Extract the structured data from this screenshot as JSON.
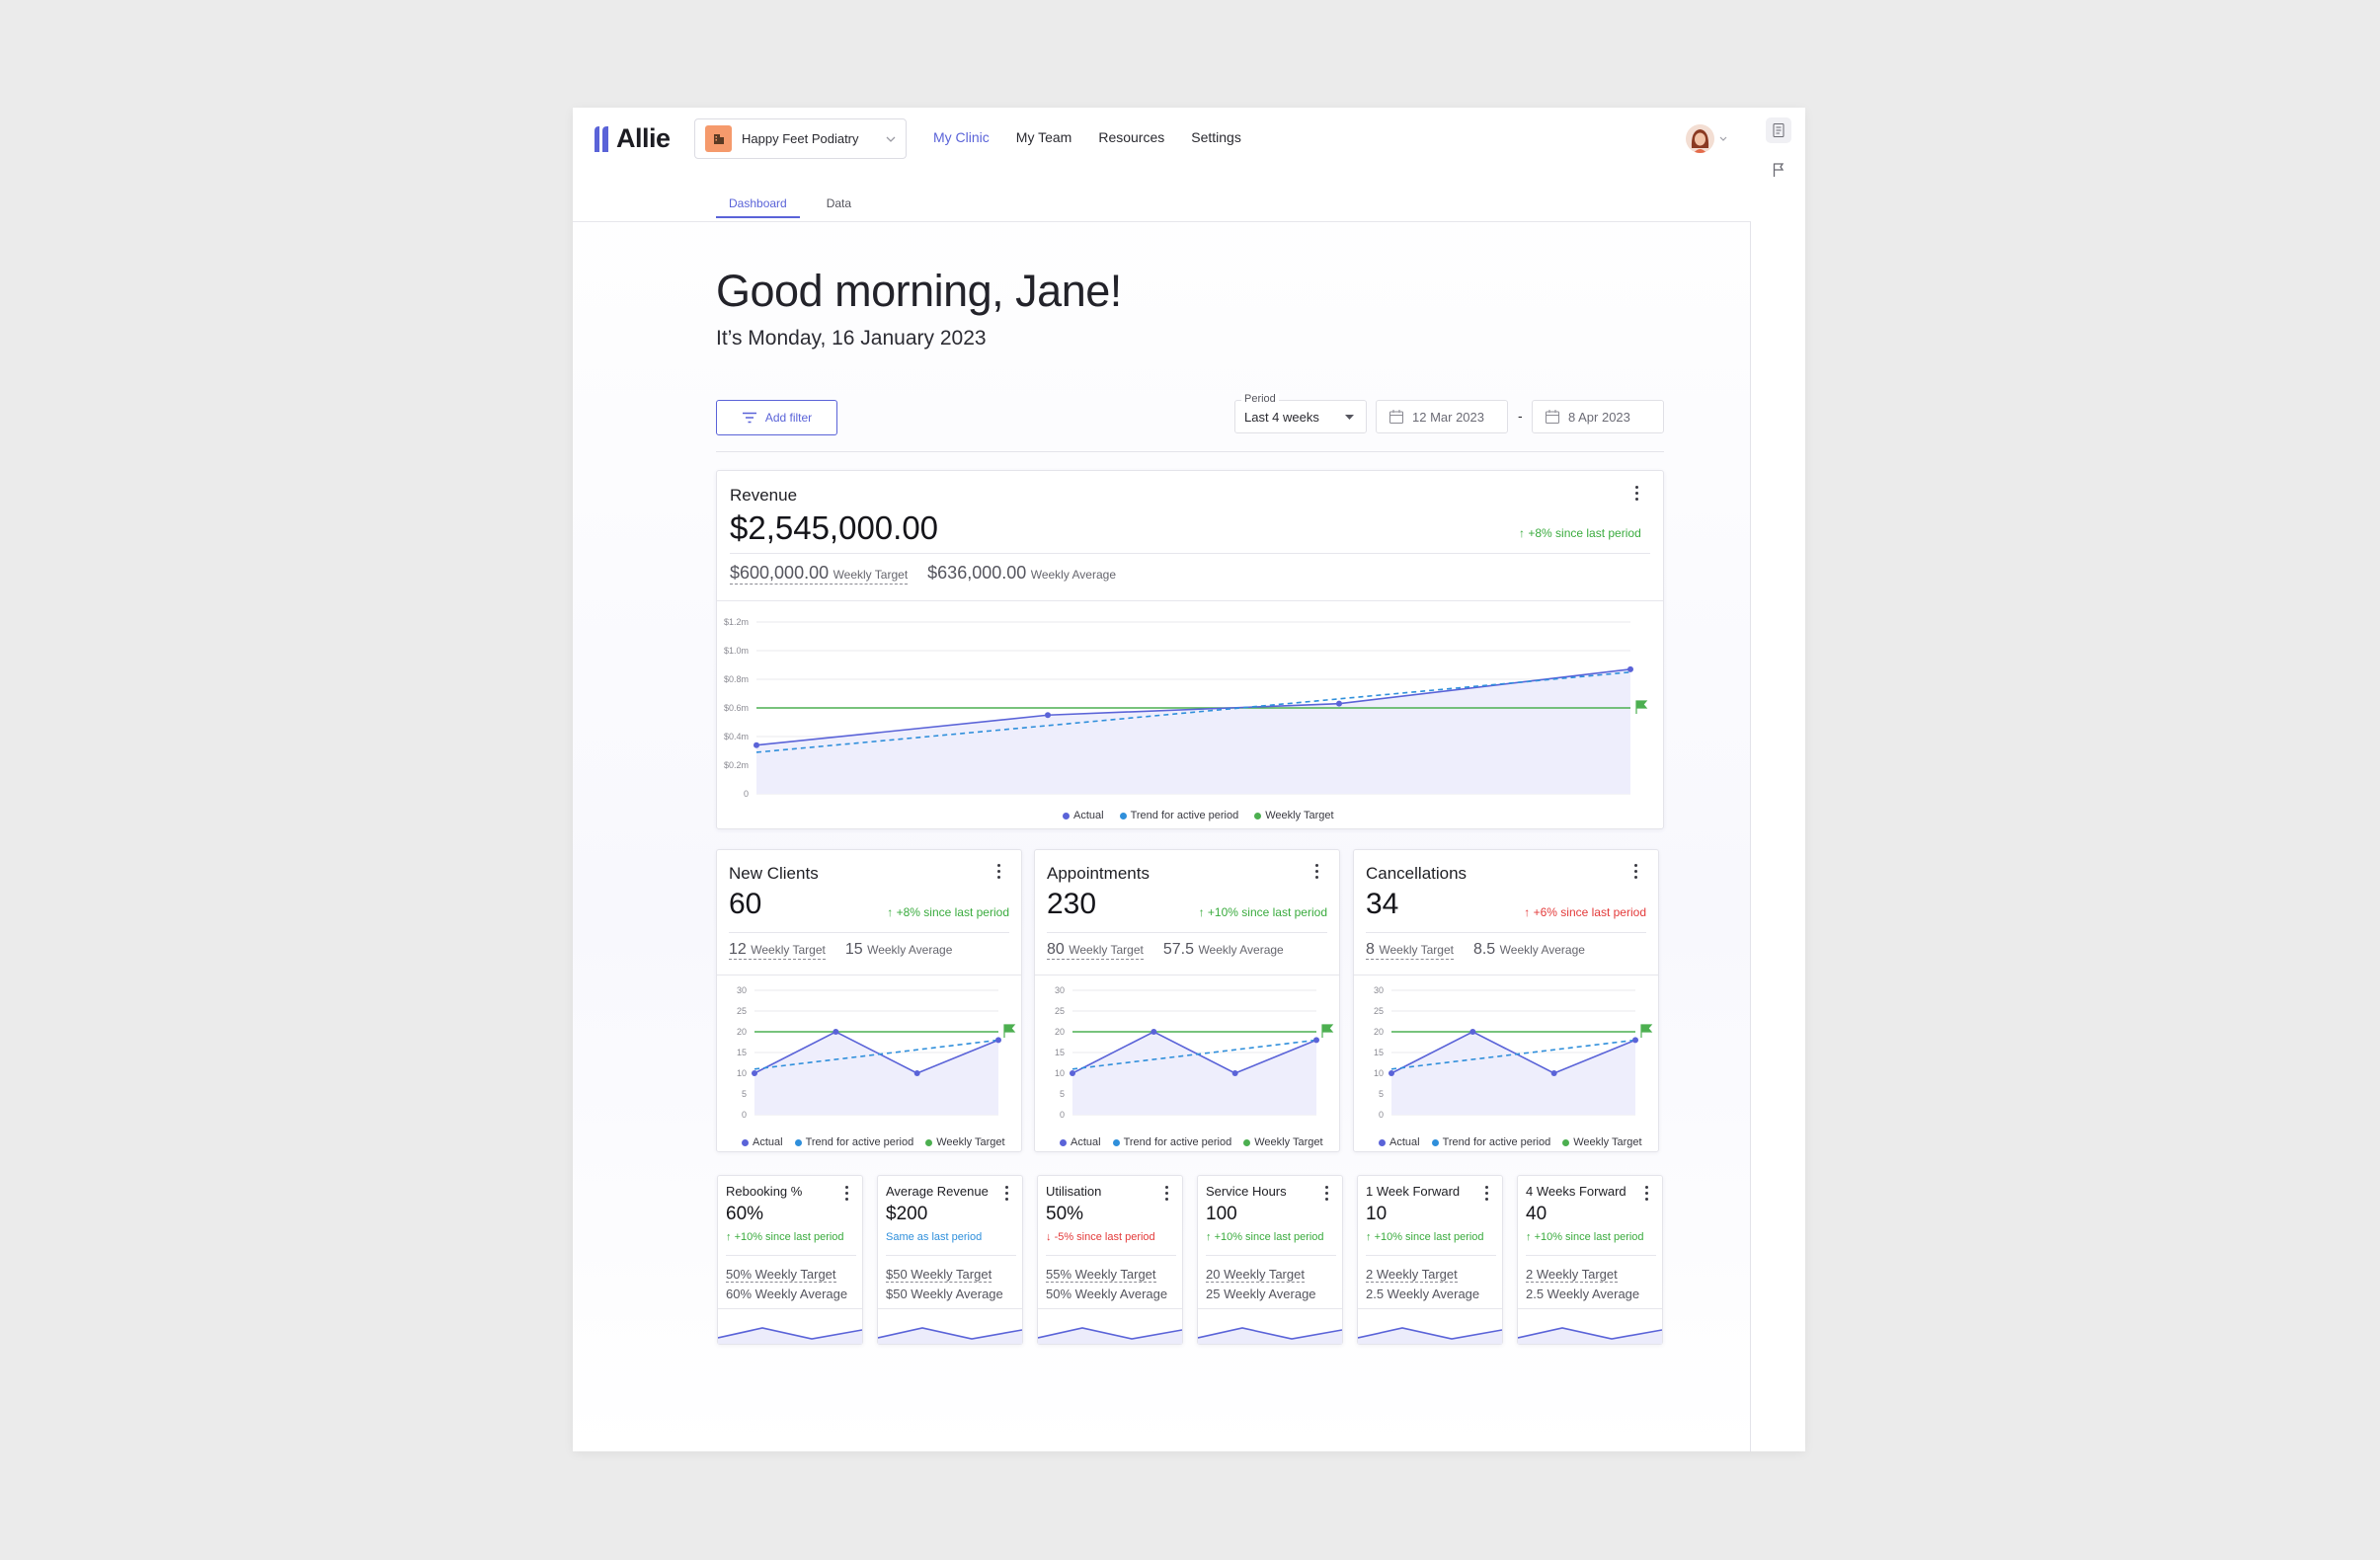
{
  "app": {
    "name": "Allie"
  },
  "header": {
    "clinic": "Happy Feet Podiatry",
    "nav": [
      "My Clinic",
      "My Team",
      "Resources",
      "Settings"
    ],
    "tabs": [
      "Dashboard",
      "Data"
    ]
  },
  "greeting": {
    "title": "Good morning, Jane!",
    "date": "It’s Monday, 16 January 2023"
  },
  "filters": {
    "add_filter": "Add filter",
    "period_label": "Period",
    "period_value": "Last 4 weeks",
    "date_from": "12 Mar 2023",
    "date_sep": "-",
    "date_to": "8 Apr 2023"
  },
  "colors": {
    "accent": "#5a63d8",
    "up": "#3aab3e",
    "down": "#e33a3a",
    "same": "#2f8fdb",
    "target": "#4caf50",
    "trend": "#2f8fdb"
  },
  "legend": {
    "actual": "Actual",
    "trend": "Trend for active period",
    "target": "Weekly Target"
  },
  "revenue": {
    "title": "Revenue",
    "value": "$2,545,000.00",
    "delta": "+8% since last period",
    "delta_dir": "up",
    "target_value": "$600,000.00",
    "target_label": "Weekly Target",
    "avg_value": "$636,000.00",
    "avg_label": "Weekly Average"
  },
  "mid_cards": [
    {
      "title": "New Clients",
      "value": "60",
      "delta": "+8% since last period",
      "dir": "up",
      "target": "12",
      "target_label": "Weekly Target",
      "avg": "15",
      "avg_label": "Weekly Average"
    },
    {
      "title": "Appointments",
      "value": "230",
      "delta": "+10% since last period",
      "dir": "up",
      "target": "80",
      "target_label": "Weekly Target",
      "avg": "57.5",
      "avg_label": "Weekly Average"
    },
    {
      "title": "Cancellations",
      "value": "34",
      "delta": "+6% since last period",
      "dir": "down",
      "target": "8",
      "target_label": "Weekly Target",
      "avg": "8.5",
      "avg_label": "Weekly Average"
    }
  ],
  "small_cards": [
    {
      "title": "Rebooking %",
      "value": "60%",
      "delta": "+10% since last period",
      "dir": "up",
      "target": "50% Weekly Target",
      "avg": "60% Weekly Average"
    },
    {
      "title": "Average Revenue",
      "value": "$200",
      "delta": "Same as last period",
      "dir": "same",
      "target": "$50 Weekly Target",
      "avg": "$50 Weekly Average"
    },
    {
      "title": "Utilisation",
      "value": "50%",
      "delta": "-5% since last period",
      "dir": "down",
      "target": "55% Weekly Target",
      "avg": "50% Weekly Average"
    },
    {
      "title": "Service Hours",
      "value": "100",
      "delta": "+10% since last period",
      "dir": "up",
      "target": "20 Weekly Target",
      "avg": "25 Weekly Average"
    },
    {
      "title": "1 Week Forward",
      "value": "10",
      "delta": "+10% since last period",
      "dir": "up",
      "target": "2 Weekly Target",
      "avg": "2.5 Weekly Average"
    },
    {
      "title": "4 Weeks Forward",
      "value": "40",
      "delta": "+10% since last period",
      "dir": "up",
      "target": "2 Weekly Target",
      "avg": "2.5 Weekly Average"
    }
  ],
  "chart_data": [
    {
      "type": "area",
      "y_ticks": [
        "$1.2m",
        "$1.0m",
        "$0.8m",
        "$0.6m",
        "$0.4m",
        "$0.2m",
        "0"
      ],
      "ylim": [
        0,
        1.2
      ],
      "series": [
        {
          "name": "Actual",
          "values": [
            0.34,
            0.55,
            0.63,
            0.87
          ]
        },
        {
          "name": "Trend for active period",
          "values": [
            0.29,
            0.85
          ]
        },
        {
          "name": "Weekly Target",
          "values": [
            0.6,
            0.6
          ]
        }
      ]
    },
    {
      "type": "area",
      "y_ticks": [
        "30",
        "25",
        "20",
        "15",
        "10",
        "5",
        "0"
      ],
      "ylim": [
        0,
        30
      ],
      "series": [
        {
          "name": "Actual",
          "values": [
            10,
            20,
            10,
            18
          ]
        },
        {
          "name": "Trend for active period",
          "values": [
            11,
            18
          ]
        },
        {
          "name": "Weekly Target",
          "values": [
            20,
            20
          ]
        }
      ]
    },
    {
      "type": "area",
      "y_ticks": [
        "30",
        "25",
        "20",
        "15",
        "10",
        "5",
        "0"
      ],
      "ylim": [
        0,
        30
      ],
      "series": [
        {
          "name": "Actual",
          "values": [
            10,
            20,
            10,
            18
          ]
        },
        {
          "name": "Trend for active period",
          "values": [
            11,
            18
          ]
        },
        {
          "name": "Weekly Target",
          "values": [
            20,
            20
          ]
        }
      ]
    },
    {
      "type": "area",
      "y_ticks": [
        "30",
        "25",
        "20",
        "15",
        "10",
        "5",
        "0"
      ],
      "ylim": [
        0,
        30
      ],
      "series": [
        {
          "name": "Actual",
          "values": [
            10,
            20,
            10,
            18
          ]
        },
        {
          "name": "Trend for active period",
          "values": [
            11,
            18
          ]
        },
        {
          "name": "Weekly Target",
          "values": [
            20,
            20
          ]
        }
      ]
    }
  ]
}
